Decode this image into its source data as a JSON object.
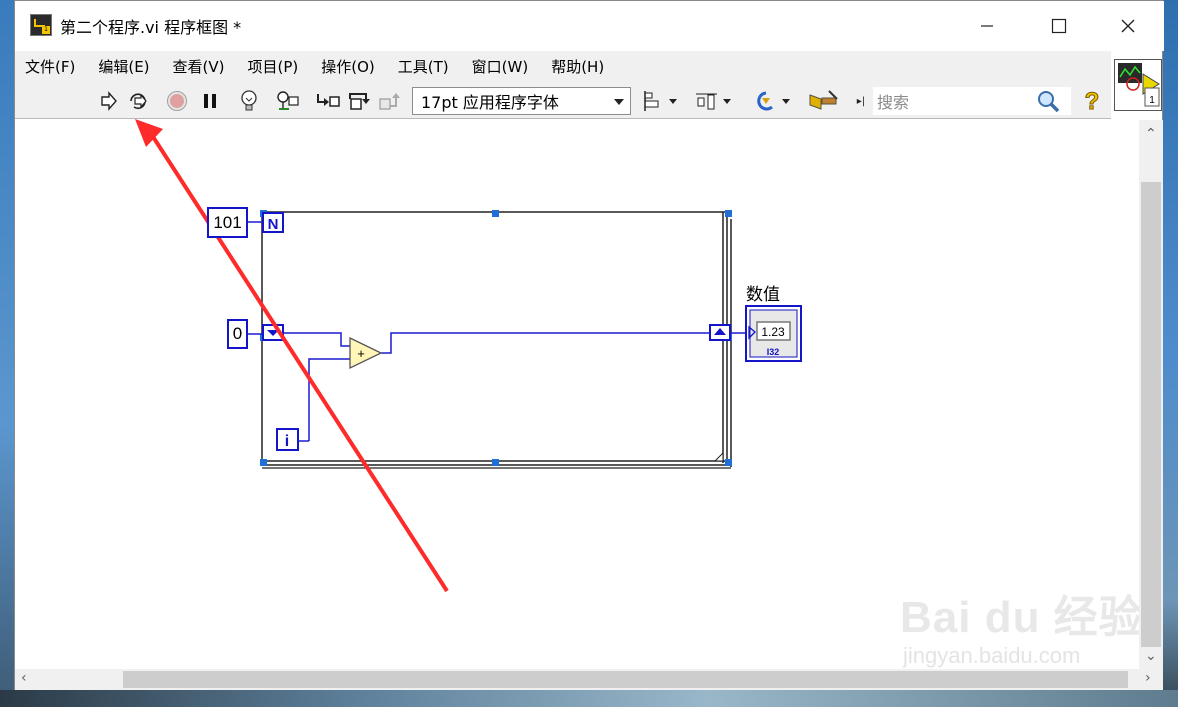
{
  "window": {
    "title": "第二个程序.vi 程序框图 *",
    "controls": [
      "minimize-icon",
      "maximize-icon",
      "close-icon"
    ]
  },
  "menu": {
    "items": [
      "文件(F)",
      "编辑(E)",
      "查看(V)",
      "项目(P)",
      "操作(O)",
      "工具(T)",
      "窗口(W)",
      "帮助(H)"
    ]
  },
  "toolbar": {
    "font_selector": "17pt 应用程序字体",
    "search_placeholder": "搜索",
    "tools": [
      "run-arrow-icon",
      "run-continuously-icon",
      "abort-icon",
      "pause-icon",
      "highlight-execution-icon",
      "retain-wire-values-icon",
      "step-into-icon",
      "step-over-icon",
      "step-out-icon",
      "align-objects-icon",
      "distribute-objects-icon",
      "reorder-icon",
      "cleanup-diagram-icon",
      "search-icon",
      "help-icon"
    ]
  },
  "vi_icon": {
    "connector_label": "1"
  },
  "diagram": {
    "count_constant": "101",
    "count_terminal": "N",
    "init_constant": "0",
    "iteration_terminal": "i",
    "add_node": "+",
    "indicator_label": "数值",
    "indicator_value": "1.23",
    "indicator_type": "I32"
  },
  "watermark": {
    "brand": "Bai du 经验",
    "url": "jingyan.baidu.com"
  },
  "colors": {
    "wire_blue": "#1a1ad0",
    "annotation_red": "#ff2a2a",
    "selection_handle": "#1f6fd8"
  }
}
